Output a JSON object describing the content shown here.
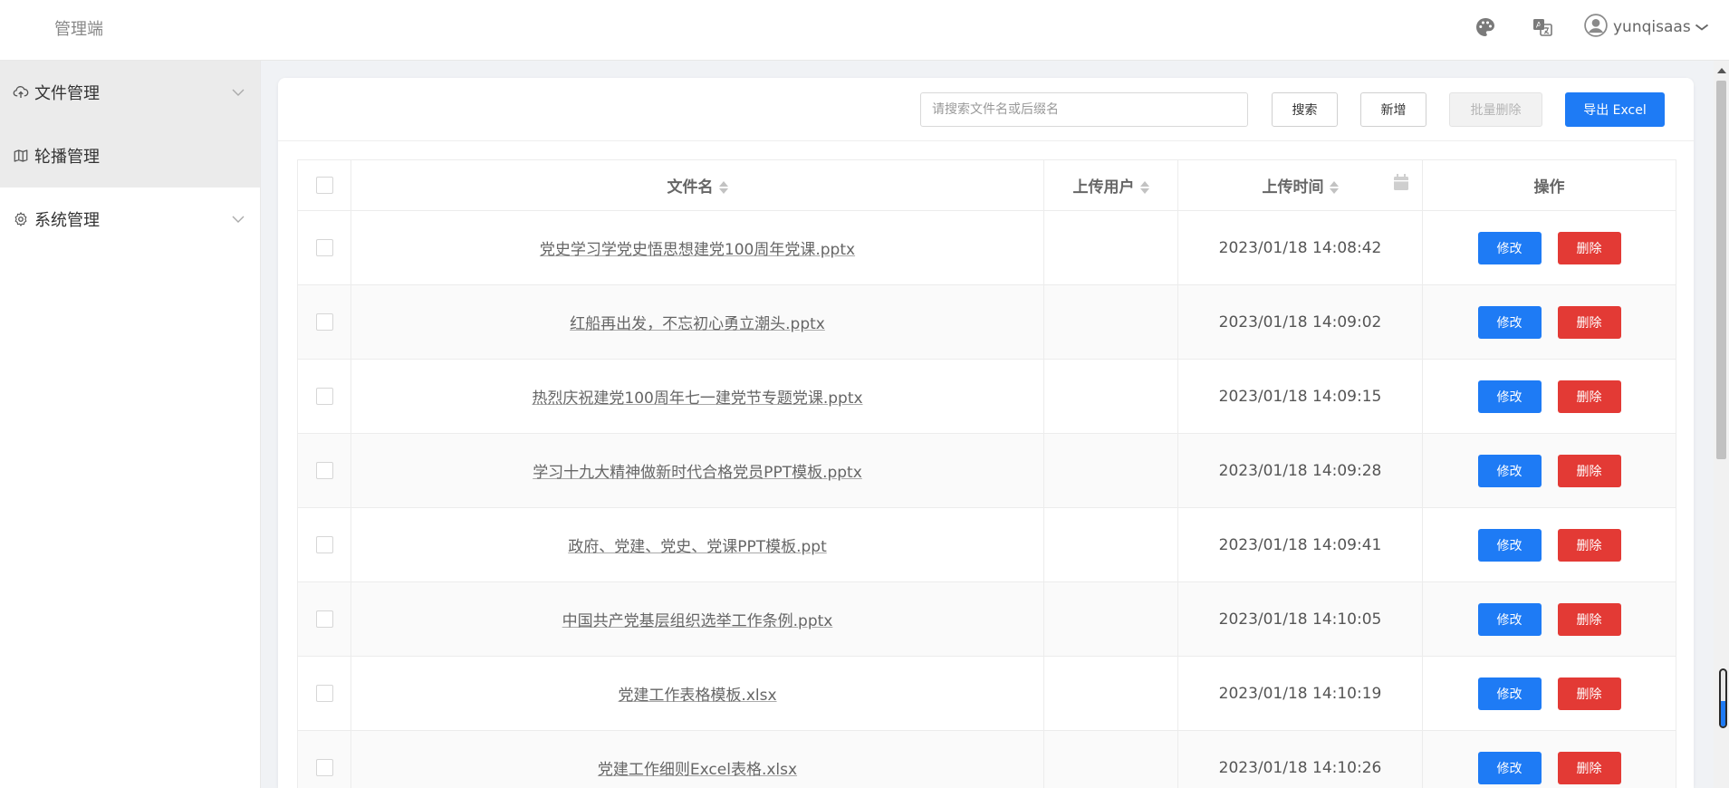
{
  "header": {
    "brand": "管理端",
    "icons": [
      "palette-icon",
      "translate-icon",
      "user-avatar-icon"
    ],
    "username": "yunqisaas"
  },
  "sidebar": {
    "items": [
      {
        "label": "文件管理",
        "icon": "cloud-upload-icon",
        "expandable": true,
        "active": true
      },
      {
        "label": "轮播管理",
        "icon": "map-icon",
        "expandable": false,
        "active": false
      },
      {
        "label": "系统管理",
        "icon": "gear-icon",
        "expandable": true,
        "active": false
      }
    ]
  },
  "toolbar": {
    "search_placeholder": "请搜索文件名或后缀名",
    "search_label": "搜索",
    "add_label": "新增",
    "batch_delete_label": "批量删除",
    "export_label": "导出 Excel"
  },
  "table": {
    "columns": {
      "filename": "文件名",
      "user": "上传用户",
      "time": "上传时间",
      "ops": "操作"
    },
    "edit_label": "修改",
    "delete_label": "删除",
    "rows": [
      {
        "filename": "党史学习学党史悟思想建党100周年党课.pptx",
        "user": "",
        "time": "2023/01/18 14:08:42"
      },
      {
        "filename": "红船再出发，不忘初心勇立潮头.pptx",
        "user": "",
        "time": "2023/01/18 14:09:02"
      },
      {
        "filename": "热烈庆祝建党100周年七一建党节专题党课.pptx",
        "user": "",
        "time": "2023/01/18 14:09:15"
      },
      {
        "filename": "学习十九大精神做新时代合格党员PPT模板.pptx",
        "user": "",
        "time": "2023/01/18 14:09:28"
      },
      {
        "filename": "政府、党建、党史、党课PPT模板.ppt",
        "user": "",
        "time": "2023/01/18 14:09:41"
      },
      {
        "filename": "中国共产党基层组织选举工作条例.pptx",
        "user": "",
        "time": "2023/01/18 14:10:05"
      },
      {
        "filename": "党建工作表格模板.xlsx",
        "user": "",
        "time": "2023/01/18 14:10:19"
      },
      {
        "filename": "党建工作细则Excel表格.xlsx",
        "user": "",
        "time": "2023/01/18 14:10:26"
      }
    ]
  },
  "colors": {
    "primary": "#1e7bf5",
    "danger": "#e33a35",
    "active_menu_bg": "#ebebeb"
  }
}
